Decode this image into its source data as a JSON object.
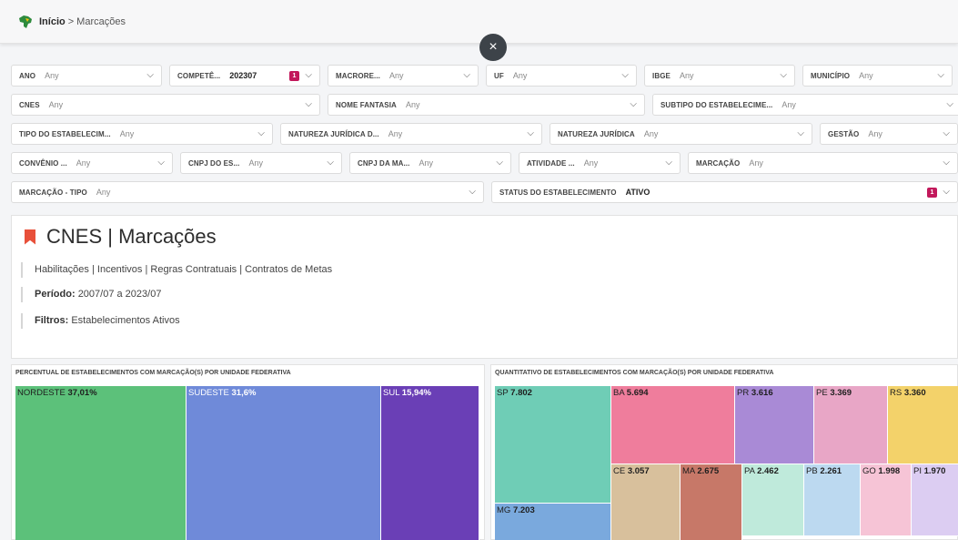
{
  "breadcrumb": {
    "home": "Início",
    "separator": ">",
    "current": "Marcações"
  },
  "icons": {
    "brand": "brazil-map-icon",
    "close": "close-icon",
    "dropdown": "chevron-down-icon",
    "bookmark": "bookmark-icon"
  },
  "close_button": {
    "glyph": "×"
  },
  "chevron": "⌵",
  "filters": {
    "ano": {
      "label": "ANO",
      "value": "Any"
    },
    "competencia": {
      "label": "COMPETÊ...",
      "value": "202307",
      "badge": "1"
    },
    "macroregiao": {
      "label": "MACRORE...",
      "value": "Any"
    },
    "uf": {
      "label": "UF",
      "value": "Any"
    },
    "ibge": {
      "label": "IBGE",
      "value": "Any"
    },
    "municipio": {
      "label": "MUNICÍPIO",
      "value": "Any"
    },
    "cnes": {
      "label": "CNES",
      "value": "Any"
    },
    "nome_fantasia": {
      "label": "NOME FANTASIA",
      "value": "Any"
    },
    "subtipo": {
      "label": "SUBTIPO DO ESTABELECIME...",
      "value": "Any"
    },
    "tipo": {
      "label": "TIPO DO ESTABELECIM...",
      "value": "Any"
    },
    "natureza_d": {
      "label": "NATUREZA JURÍDICA D...",
      "value": "Any"
    },
    "natureza": {
      "label": "NATUREZA JURÍDICA",
      "value": "Any"
    },
    "gestao": {
      "label": "GESTÃO",
      "value": "Any"
    },
    "convenio": {
      "label": "CONVÊNIO ...",
      "value": "Any"
    },
    "cnpj_es": {
      "label": "CNPJ DO ES...",
      "value": "Any"
    },
    "cnpj_ma": {
      "label": "CNPJ DA MA...",
      "value": "Any"
    },
    "atividade": {
      "label": "ATIVIDADE ...",
      "value": "Any"
    },
    "marcacao": {
      "label": "MARCAÇÃO",
      "value": "Any"
    },
    "marcacao_tipo": {
      "label": "MARCAÇÃO - TIPO",
      "value": "Any"
    },
    "status": {
      "label": "STATUS DO ESTABELECIMENTO",
      "value": "ATIVO",
      "badge": "1"
    }
  },
  "card": {
    "title": "CNES | Marcações",
    "links": "Habilitações | Incentivos | Regras Contratuais | Contratos de Metas",
    "periodo_label": "Período:",
    "periodo_value": "2007/07 a 2023/07",
    "filtros_label": "Filtros:",
    "filtros_value": "Estabelecimentos Ativos"
  },
  "chart_data": [
    {
      "type": "treemap",
      "title": "PERCENTUAL DE ESTABELECIMENTOS COM MARCAÇÃO(S) POR UNIDADE FEDERATIVA",
      "items": [
        {
          "name": "NORDESTE",
          "label": "37,01%",
          "value": 37.01,
          "color": "#5cc17a"
        },
        {
          "name": "SUDESTE",
          "label": "31,6%",
          "value": 31.6,
          "color": "#6f8ad9"
        },
        {
          "name": "SUL",
          "label": "15,94%",
          "value": 15.94,
          "color": "#6a3fb6"
        }
      ]
    },
    {
      "type": "treemap",
      "title": "QUANTITATIVO DE ESTABELECIMENTOS COM MARCAÇÃO(S) POR UNIDADE FEDERATIVA",
      "items": [
        {
          "name": "SP",
          "label": "7.802",
          "value": 7802,
          "color": "#6fcdb6"
        },
        {
          "name": "MG",
          "label": "7.203",
          "value": 7203,
          "color": "#7aa9dd"
        },
        {
          "name": "BA",
          "label": "5.694",
          "value": 5694,
          "color": "#ef7d9c"
        },
        {
          "name": "PR",
          "label": "3.616",
          "value": 3616,
          "color": "#a98ad6"
        },
        {
          "name": "PE",
          "label": "3.369",
          "value": 3369,
          "color": "#e8a6c6"
        },
        {
          "name": "RS",
          "label": "3.360",
          "value": 3360,
          "color": "#f3d26a"
        },
        {
          "name": "CE",
          "label": "3.057",
          "value": 3057,
          "color": "#d8c09c"
        },
        {
          "name": "MA",
          "label": "2.675",
          "value": 2675,
          "color": "#c77868"
        },
        {
          "name": "PA",
          "label": "2.462",
          "value": 2462,
          "color": "#bfeadb"
        },
        {
          "name": "PB",
          "label": "2.261",
          "value": 2261,
          "color": "#bcd9f0"
        },
        {
          "name": "GO",
          "label": "1.998",
          "value": 1998,
          "color": "#f6c4d6"
        },
        {
          "name": "PI",
          "label": "1.970",
          "value": 1970,
          "color": "#dccdf2"
        }
      ]
    }
  ]
}
